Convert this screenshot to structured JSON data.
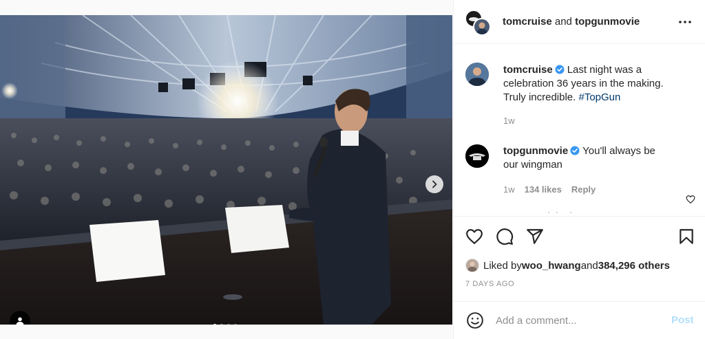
{
  "post": {
    "header": {
      "author": "tomcruise",
      "connector": " and ",
      "collaborator": "topgunmovie",
      "more_icon": "more-horizontal-icon"
    },
    "media": {
      "slide_count": 4,
      "active_slide": 1,
      "next_icon": "chevron-right-icon",
      "tag_icon": "user-tag-icon"
    },
    "caption": {
      "username": "tomcruise",
      "verified": true,
      "text": "Last night was a celebration 36 years in the making. Truly incredible. ",
      "hashtag": "#TopGun",
      "time": "1w"
    },
    "comments": [
      {
        "username": "topgunmovie",
        "verified": true,
        "text": "You'll always be our wingman",
        "time": "1w",
        "likes": "134 likes",
        "reply_label": "Reply",
        "like_icon": "heart-outline-icon"
      }
    ],
    "actions": {
      "like_icon": "heart-outline-icon",
      "comment_icon": "comment-bubble-icon",
      "share_icon": "paper-plane-icon",
      "save_icon": "bookmark-icon"
    },
    "likes": {
      "prefix": "Liked by ",
      "user": "woo_hwang",
      "middle": " and ",
      "others": "384,296 others"
    },
    "timestamp": "7 DAYS AGO",
    "add_comment": {
      "placeholder": "Add a comment...",
      "post_label": "Post",
      "emoji_icon": "emoji-icon"
    },
    "colors": {
      "link": "#00376b",
      "verified": "#3897f0",
      "post_disabled": "#b2dffc",
      "secondary_text": "#8e8e8e"
    }
  }
}
